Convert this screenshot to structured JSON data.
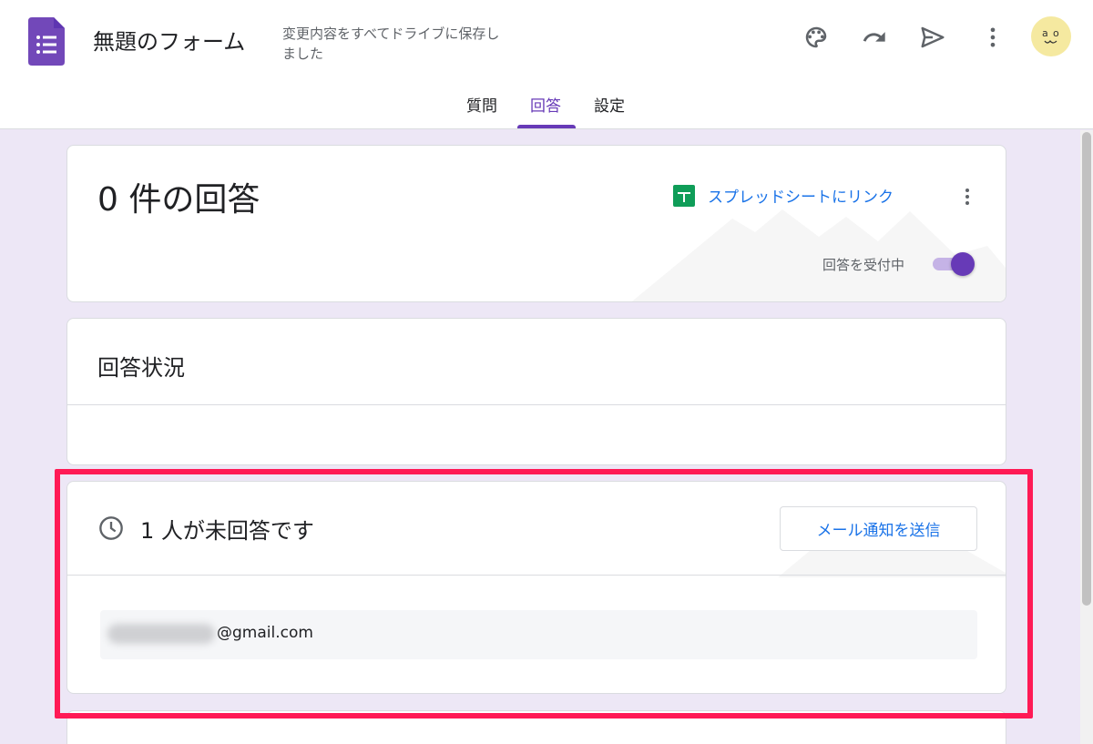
{
  "header": {
    "title": "無題のフォーム",
    "save_status": "変更内容をすべてドライブに保存しました",
    "icons": [
      "palette-icon",
      "undo-icon",
      "send-icon",
      "more-vert-icon"
    ],
    "avatar_text": "a o"
  },
  "tabs": [
    {
      "label": "質問",
      "active": false
    },
    {
      "label": "回答",
      "active": true
    },
    {
      "label": "設定",
      "active": false
    }
  ],
  "responses_card": {
    "count_text": "0 件の回答",
    "sheet_link_label": "スプレッドシートにリンク",
    "accepting_label": "回答を受付中",
    "accepting": true
  },
  "status_card": {
    "title": "回答状況"
  },
  "pending_card": {
    "title": "1 人が未回答です",
    "notify_button": "メール通知を送信",
    "email_suffix": "@gmail.com"
  },
  "colors": {
    "accent": "#673ab7",
    "link": "#1a73e8",
    "background": "#ede7f6",
    "highlight": "#ff1a55",
    "sheets_green": "#0f9d58"
  }
}
